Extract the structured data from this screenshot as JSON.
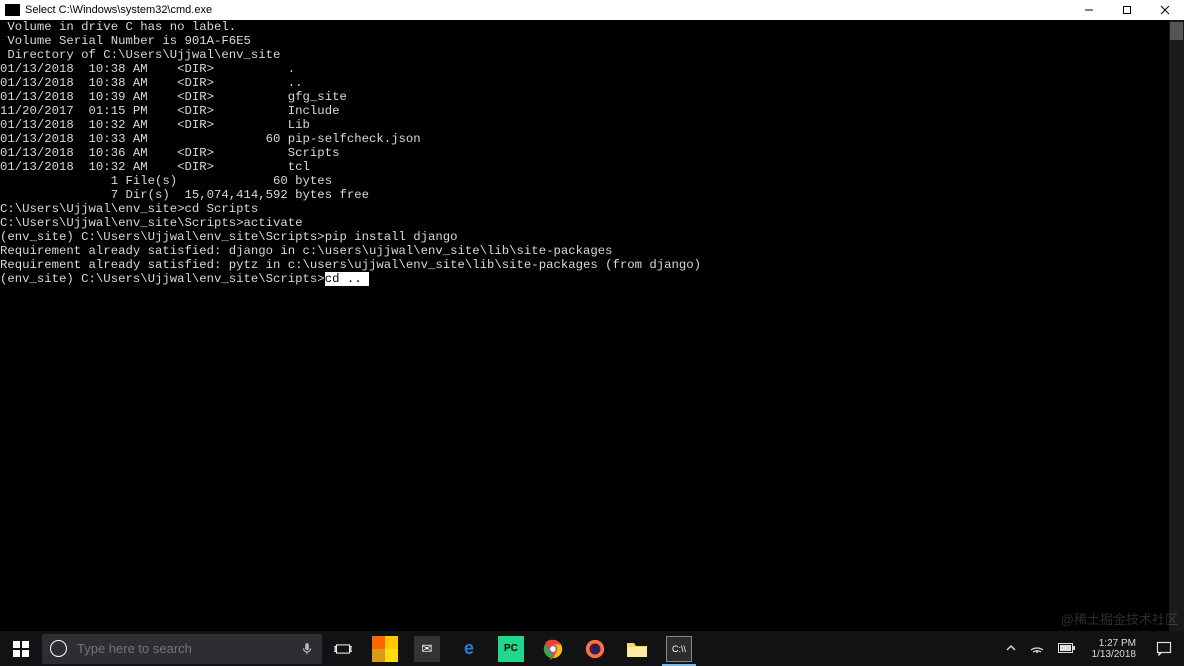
{
  "window": {
    "title": "Select C:\\Windows\\system32\\cmd.exe"
  },
  "terminal": {
    "lines": [
      " Volume in drive C has no label.",
      " Volume Serial Number is 901A-F6E5",
      "",
      " Directory of C:\\Users\\Ujjwal\\env_site",
      "",
      "01/13/2018  10:38 AM    <DIR>          .",
      "01/13/2018  10:38 AM    <DIR>          ..",
      "01/13/2018  10:39 AM    <DIR>          gfg_site",
      "11/20/2017  01:15 PM    <DIR>          Include",
      "01/13/2018  10:32 AM    <DIR>          Lib",
      "01/13/2018  10:33 AM                60 pip-selfcheck.json",
      "01/13/2018  10:36 AM    <DIR>          Scripts",
      "01/13/2018  10:32 AM    <DIR>          tcl",
      "               1 File(s)             60 bytes",
      "               7 Dir(s)  15,074,414,592 bytes free",
      "",
      "C:\\Users\\Ujjwal\\env_site>cd Scripts",
      "",
      "C:\\Users\\Ujjwal\\env_site\\Scripts>activate",
      "",
      "(env_site) C:\\Users\\Ujjwal\\env_site\\Scripts>pip install django",
      "Requirement already satisfied: django in c:\\users\\ujjwal\\env_site\\lib\\site-packages",
      "Requirement already satisfied: pytz in c:\\users\\ujjwal\\env_site\\lib\\site-packages (from django)",
      ""
    ],
    "prompt_prefix": "(env_site) C:\\Users\\Ujjwal\\env_site\\Scripts>",
    "selected_input": "cd ..",
    "selected_trail": " "
  },
  "taskbar": {
    "search_placeholder": "Type here to search",
    "clock_time": "1:27 PM",
    "clock_date": "1/13/2018"
  },
  "watermark": "@稀土掘金技术社区"
}
